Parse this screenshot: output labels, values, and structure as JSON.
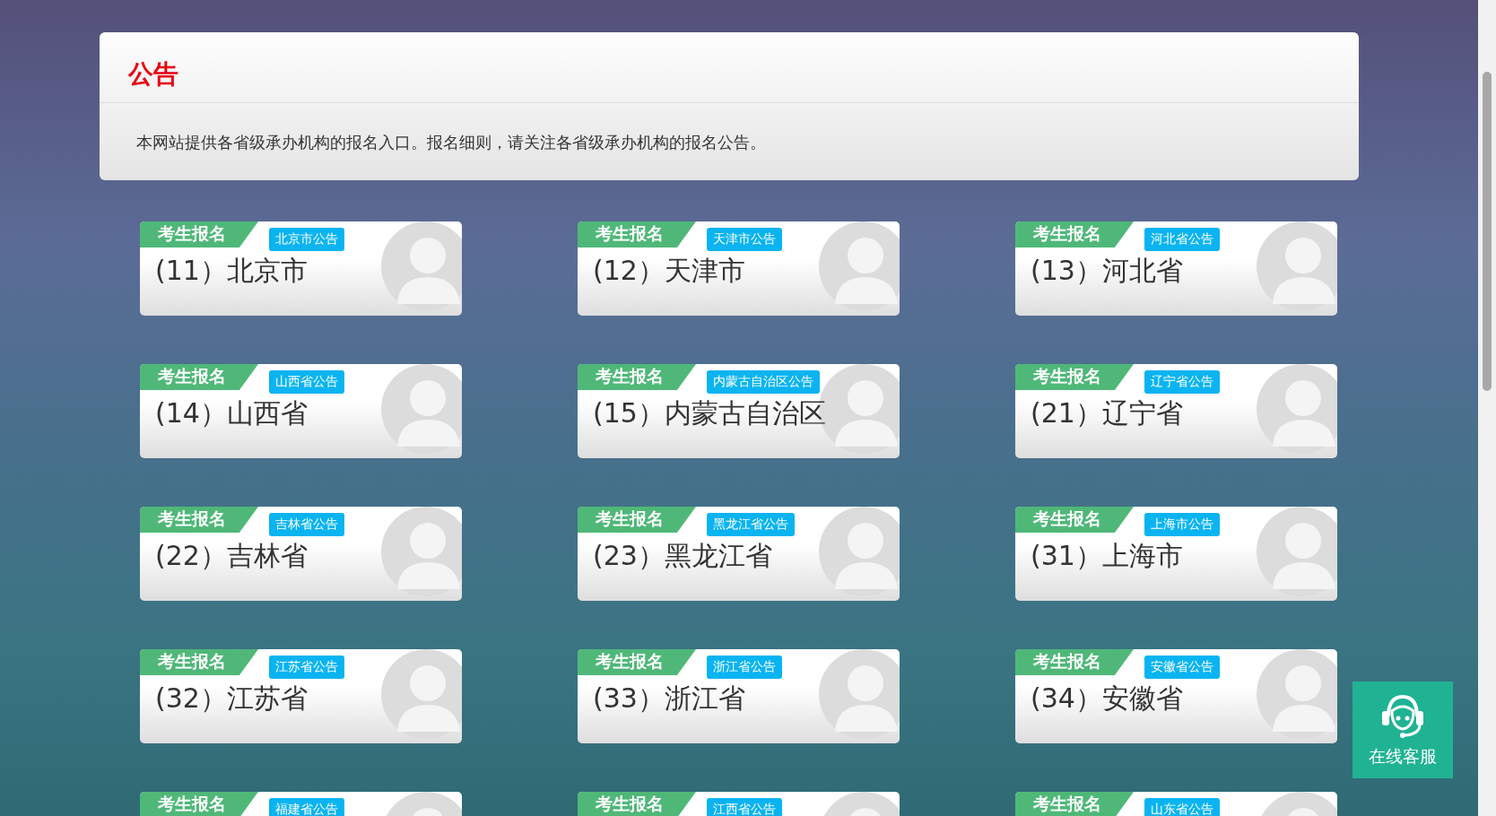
{
  "notice": {
    "title": "公告",
    "text": "本网站提供各省级承办机构的报名入口。报名细则，请关注各省级承办机构的报名公告。"
  },
  "cards": [
    {
      "badge": "考生报名",
      "tag": "北京市公告",
      "title": "(11）北京市"
    },
    {
      "badge": "考生报名",
      "tag": "天津市公告",
      "title": "(12）天津市"
    },
    {
      "badge": "考生报名",
      "tag": "河北省公告",
      "title": "(13）河北省"
    },
    {
      "badge": "考生报名",
      "tag": "山西省公告",
      "title": "(14）山西省"
    },
    {
      "badge": "考生报名",
      "tag": "内蒙古自治区公告",
      "title": "(15）内蒙古自治区"
    },
    {
      "badge": "考生报名",
      "tag": "辽宁省公告",
      "title": "(21）辽宁省"
    },
    {
      "badge": "考生报名",
      "tag": "吉林省公告",
      "title": "(22）吉林省"
    },
    {
      "badge": "考生报名",
      "tag": "黑龙江省公告",
      "title": "(23）黑龙江省"
    },
    {
      "badge": "考生报名",
      "tag": "上海市公告",
      "title": "(31）上海市"
    },
    {
      "badge": "考生报名",
      "tag": "江苏省公告",
      "title": "(32）江苏省"
    },
    {
      "badge": "考生报名",
      "tag": "浙江省公告",
      "title": "(33）浙江省"
    },
    {
      "badge": "考生报名",
      "tag": "安徽省公告",
      "title": "(34）安徽省"
    },
    {
      "badge": "考生报名",
      "tag": "福建省公告"
    },
    {
      "badge": "考生报名",
      "tag": "江西省公告"
    },
    {
      "badge": "考生报名",
      "tag": "山东省公告"
    }
  ],
  "service_button": {
    "label": "在线客服"
  }
}
